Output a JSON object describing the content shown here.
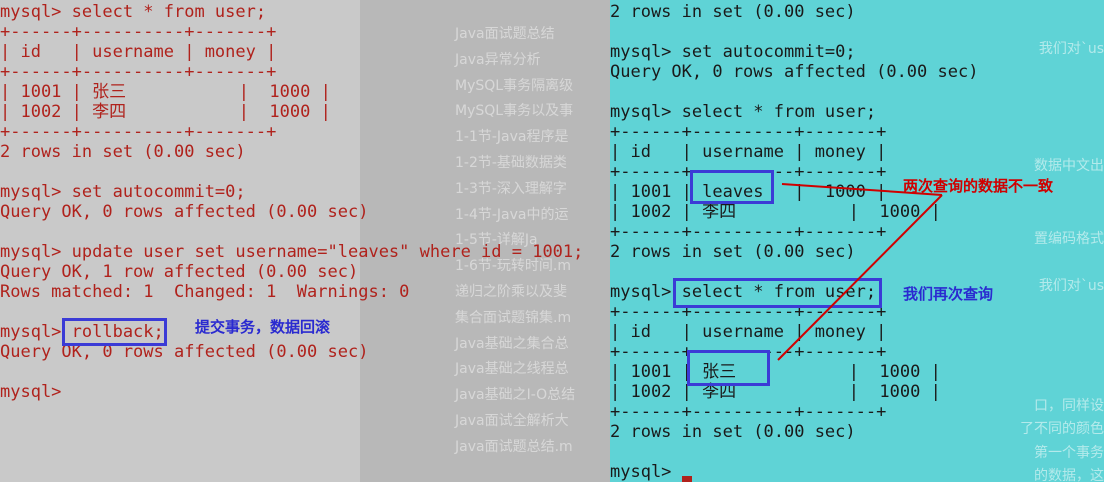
{
  "colors": {
    "left_text": "#b0221c",
    "right_text": "#1a1a1a",
    "highlight_box": "#3b3bd6",
    "left_bg": "#c9c9c9",
    "right_bg": "#5fd3d6",
    "annotation_red": "#d00000",
    "annotation_blue": "#2a2ad0"
  },
  "left_terminal": {
    "lines": [
      "mysql> select * from user;",
      "+------+----------+-------+",
      "| id   | username | money |",
      "+------+----------+-------+",
      "| 1001 | 张三           |  1000 |",
      "| 1002 | 李四           |  1000 |",
      "+------+----------+-------+",
      "2 rows in set (0.00 sec)",
      "",
      "mysql> set autocommit=0;",
      "Query OK, 0 rows affected (0.00 sec)",
      "",
      "mysql> update user set username=\"leaves\" where id = 1001;",
      "Query OK, 1 row affected (0.00 sec)",
      "Rows matched: 1  Changed: 1  Warnings: 0",
      "",
      "mysql> rollback;",
      "Query OK, 0 rows affected (0.00 sec)",
      "",
      "mysql>"
    ]
  },
  "right_terminal": {
    "lines": [
      "2 rows in set (0.00 sec)",
      "",
      "mysql> set autocommit=0;",
      "Query OK, 0 rows affected (0.00 sec)",
      "",
      "mysql> select * from user;",
      "+------+----------+-------+",
      "| id   | username | money |",
      "+------+----------+-------+",
      "| 1001 | leaves   |  1000 |",
      "| 1002 | 李四           |  1000 |",
      "+------+----------+-------+",
      "2 rows in set (0.00 sec)",
      "",
      "mysql> select * from user;",
      "+------+----------+-------+",
      "| id   | username | money |",
      "+------+----------+-------+",
      "| 1001 | 张三           |  1000 |",
      "| 1002 | 李四           |  1000 |",
      "+------+----------+-------+",
      "2 rows in set (0.00 sec)",
      "",
      "mysql> "
    ]
  },
  "annotations": {
    "rollback_note": "提交事务，数据回滚",
    "mismatch_note": "两次查询的数据不一致",
    "requery_note": "我们再次查询"
  },
  "background_sidebar": {
    "items": [
      "Java面试题总结",
      "Java异常分析",
      "MySQL事务隔离级",
      "MySQL事务以及事",
      "1-1节-Java程序是",
      "1-2节-基础数据类",
      "1-3节-深入理解字",
      "1-4节-Java中的运",
      "1-5节-详解Ja",
      "1-6节-玩转时间.m",
      "递归之阶乘以及斐",
      "集合面试题锦集.m",
      "Java基础之集合总",
      "Java基础之线程总",
      "Java基础之I-O总结",
      "Java面试全解析大",
      "Java面试题总结.m"
    ]
  },
  "background_right": {
    "items": [
      "我们对`us",
      "数据中文出",
      "置编码格式",
      "我们对`us",
      "口，同样设",
      "了不同的颜色",
      "第一个事务",
      "的数据，这"
    ]
  }
}
